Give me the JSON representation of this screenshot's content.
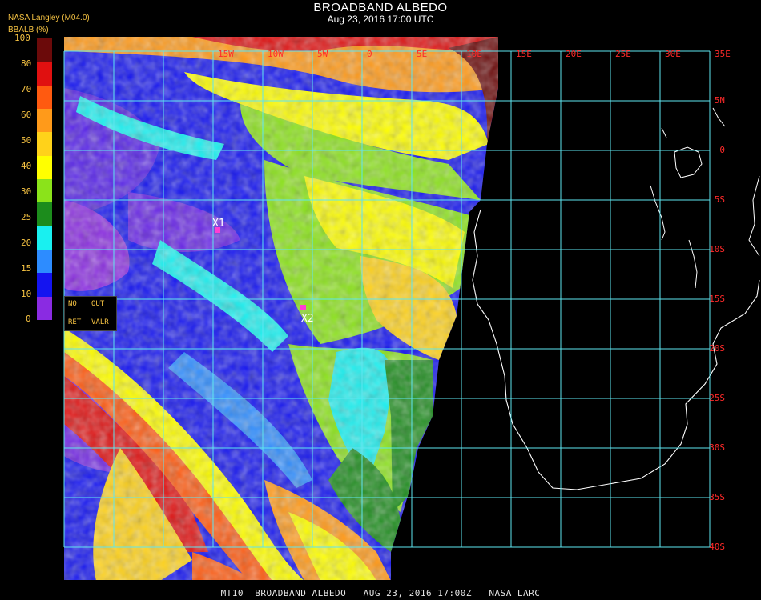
{
  "header": {
    "title": "BROADBAND ALBEDO",
    "subtitle": "Aug 23, 2016 17:00 UTC",
    "org": "NASA Langley (M04.0)",
    "unit": "BBALB (%)"
  },
  "legend": {
    "labels": [
      "100",
      "80",
      "70",
      "60",
      "50",
      "40",
      "30",
      "25",
      "20",
      "15",
      "10",
      "0"
    ],
    "colors": [
      "#6b0a0a",
      "#e01010",
      "#ff5a10",
      "#ff9a1a",
      "#ffd21a",
      "#ffff00",
      "#8be31a",
      "#1c8c1c",
      "#19f0f0",
      "#2d8cff",
      "#1414f0",
      "#8a2be2"
    ]
  },
  "flags": {
    "no": "NO",
    "out": "OUT",
    "ret": "RET",
    "valr": "VALR"
  },
  "map": {
    "lon_labels": [
      "15W",
      "10W",
      "5W",
      "0",
      "5E",
      "10E",
      "15E",
      "20E",
      "25E",
      "30E",
      "35E"
    ],
    "lat_labels": [
      "5N",
      "0",
      "5S",
      "10S",
      "15S",
      "20S",
      "25S",
      "30S",
      "35S",
      "40S"
    ],
    "markers": [
      "X1",
      "X2"
    ]
  },
  "footer": "MT10  BROADBAND ALBEDO   AUG 23, 2016 17:00Z   NASA LARC"
}
